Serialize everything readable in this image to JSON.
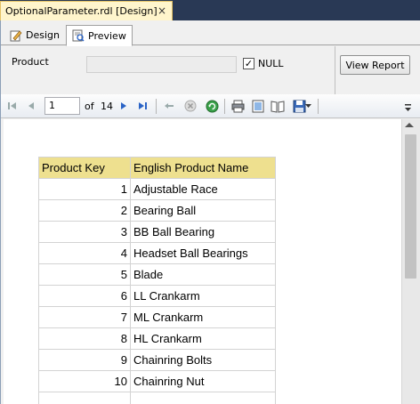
{
  "document_tab": {
    "title": "OptionalParameter.rdl [Design]",
    "close_glyph": "×"
  },
  "view_tabs": [
    {
      "label": "Design"
    },
    {
      "label": "Preview"
    }
  ],
  "parameters": {
    "product_label": "Product",
    "product_value": "",
    "null_checked": true,
    "null_check_glyph": "✓",
    "null_label": "NULL",
    "view_report_label": "View Report"
  },
  "toolbar": {
    "current_page": "1",
    "of_label": "of",
    "total_pages": "14",
    "icons": {
      "first": "first-page-icon",
      "previous": "previous-page-icon",
      "next": "next-page-icon",
      "last": "last-page-icon",
      "back": "back-to-parent-icon",
      "stop": "stop-icon",
      "refresh": "refresh-icon",
      "print": "print-icon",
      "print_layout": "print-layout-icon",
      "page_setup": "page-setup-icon",
      "export": "export-icon"
    }
  },
  "report": {
    "columns": [
      "Product Key",
      "English Product Name"
    ],
    "rows": [
      {
        "key": "1",
        "name": "Adjustable Race"
      },
      {
        "key": "2",
        "name": "Bearing Ball"
      },
      {
        "key": "3",
        "name": "BB Ball Bearing"
      },
      {
        "key": "4",
        "name": "Headset Ball Bearings"
      },
      {
        "key": "5",
        "name": "Blade"
      },
      {
        "key": "6",
        "name": "LL Crankarm"
      },
      {
        "key": "7",
        "name": "ML Crankarm"
      },
      {
        "key": "8",
        "name": "HL Crankarm"
      },
      {
        "key": "9",
        "name": "Chainring Bolts"
      },
      {
        "key": "10",
        "name": "Chainring Nut"
      },
      {
        "key": "",
        "name": ""
      }
    ]
  },
  "colors": {
    "header_fill": "#eee08f",
    "doc_tab_fill": "#fff5cc",
    "ide_background": "#293955"
  }
}
